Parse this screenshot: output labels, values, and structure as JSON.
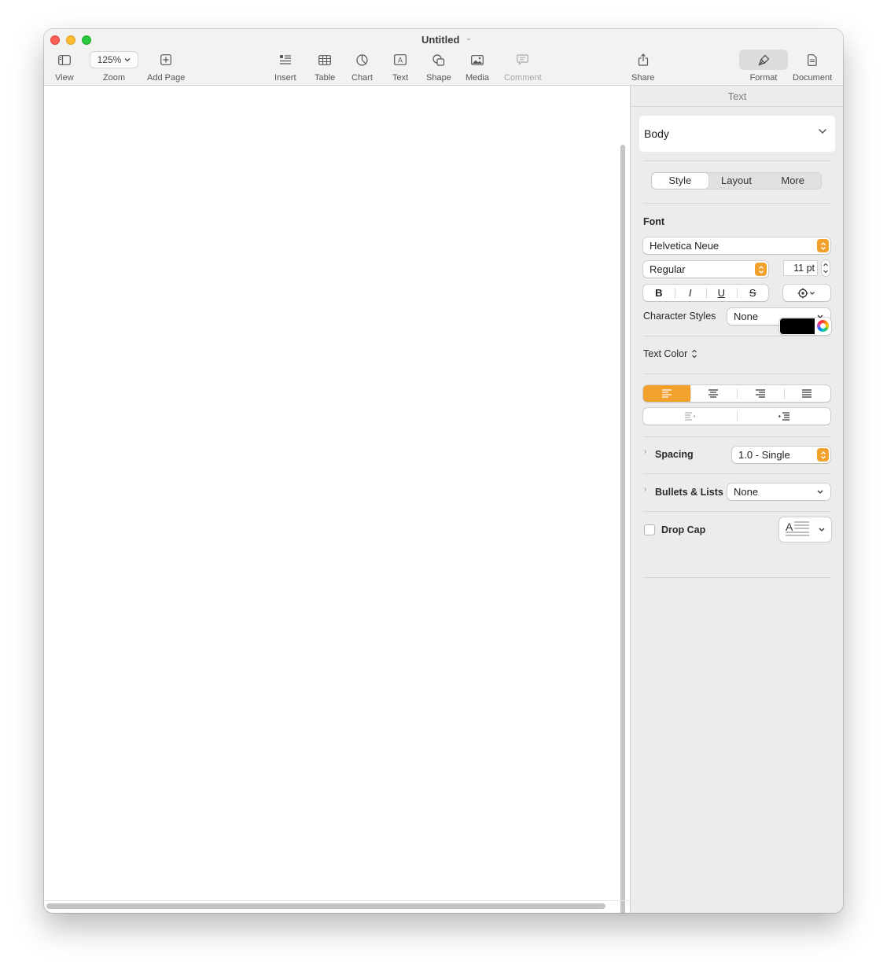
{
  "window": {
    "title": "Untitled"
  },
  "toolbar": {
    "view": "View",
    "zoom_value": "125%",
    "zoom": "Zoom",
    "add_page": "Add Page",
    "insert": "Insert",
    "table": "Table",
    "chart": "Chart",
    "text": "Text",
    "shape": "Shape",
    "media": "Media",
    "comment": "Comment",
    "share": "Share",
    "format": "Format",
    "document": "Document"
  },
  "inspector": {
    "header": "Text",
    "paragraph_style": "Body",
    "tabs": [
      "Style",
      "Layout",
      "More"
    ],
    "active_tab": "Style",
    "font_label": "Font",
    "font_family": "Helvetica Neue",
    "font_typeface": "Regular",
    "font_size": "11 pt",
    "bold_label": "B",
    "italic_label": "I",
    "underline_label": "U",
    "strike_label": "S",
    "character_styles_label": "Character Styles",
    "character_styles_value": "None",
    "text_color_label": "Text Color",
    "text_color": "#000000",
    "alignment_active": "left",
    "spacing_label": "Spacing",
    "spacing_value": "1.0 - Single",
    "bullets_label": "Bullets & Lists",
    "bullets_value": "None",
    "drop_cap_label": "Drop Cap",
    "drop_cap_checked": false
  },
  "colors": {
    "accent": "#f2a12c",
    "close": "#fe5f57",
    "minimize": "#febc2e",
    "maximize": "#28c840"
  }
}
